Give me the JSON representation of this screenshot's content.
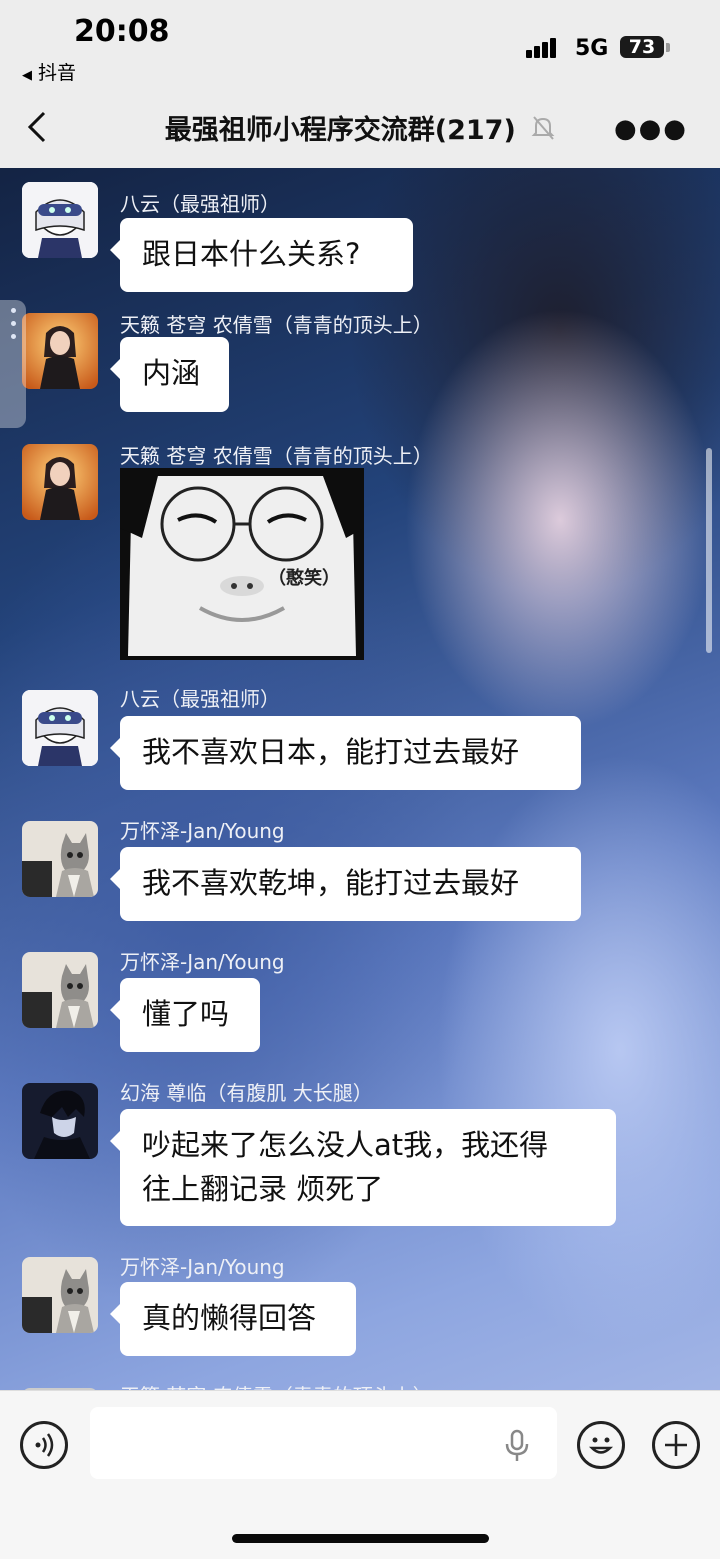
{
  "status_bar": {
    "time": "20:08",
    "back_app": "抖音",
    "network": "5G",
    "battery": "73"
  },
  "header": {
    "title": "最强祖师小程序交流群(217)"
  },
  "messages": [
    {
      "sender": "八云（最强祖师）",
      "text": "跟日本什么关系?",
      "avatar": "anime-masked-avatar"
    },
    {
      "sender": "天籁 苍穹 农倩雪（青青的顶头上）",
      "text": "内涵",
      "avatar": "anime-girl-avatar"
    },
    {
      "sender": "天籁 苍穹 农倩雪（青青的顶头上）",
      "sticker_text": "（憨笑）",
      "avatar": "anime-girl-avatar"
    },
    {
      "sender": "八云（最强祖师）",
      "text": "我不喜欢日本，能打过去最好",
      "avatar": "anime-masked-avatar"
    },
    {
      "sender": "万怀泽-Jan/Young",
      "text": "我不喜欢乾坤，能打过去最好",
      "avatar": "cat-avatar"
    },
    {
      "sender": "万怀泽-Jan/Young",
      "text": "懂了吗",
      "avatar": "cat-avatar"
    },
    {
      "sender": "幻海 尊临（有腹肌 大长腿）",
      "text_line1": "吵起来了怎么没人at我，我还得",
      "text_line2": "往上翻记录 烦死了",
      "avatar": "dark-anime-avatar"
    },
    {
      "sender": "万怀泽-Jan/Young",
      "text": "真的懒得回答",
      "avatar": "cat-avatar"
    },
    {
      "sender": "天籁 苍穹 农倩雪（青青的顶头上）"
    }
  ],
  "input": {
    "value": ""
  }
}
